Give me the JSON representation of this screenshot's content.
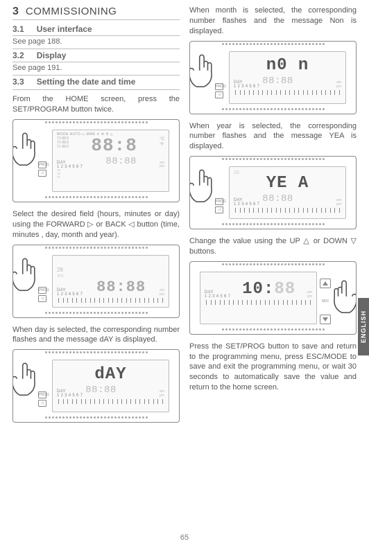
{
  "section": {
    "num": "3",
    "title": "COMMISSIONING"
  },
  "s31": {
    "num": "3.1",
    "title": "User interface",
    "see": "See page 188."
  },
  "s32": {
    "num": "3.2",
    "title": "Display",
    "see": "See page 191."
  },
  "s33": {
    "num": "3.3",
    "title": "Setting the date and time"
  },
  "left": {
    "p1": "From the HOME screen, press the SET/PROGRAM button twice.",
    "p2": "Select the desired field (hours, minutes or day) using the FORWARD ▷ or BACK ◁ button (time, minutes , day, month and year).",
    "p3": "When day is selected, the corresponding number flashes and the message dAY is displayed."
  },
  "right": {
    "p1": "When month is selected, the corresponding number flashes and the message Non is displayed.",
    "p2": "When year is selected, the corresponding number flashes and the message YEA is displayed.",
    "p3": "Change the value using the UP △ or DOWN ▽ buttons.",
    "p4": "Press the SET/PROG button to save and return to the programming menu, press ESC/MODE to save and exit the programming menu, or wait 30 seconds to automatically save the value and return to the home screen."
  },
  "lcd": {
    "mode_row": "MODE  AUTO ◇ MAN ☀ ❄ ⏱ △",
    "t_rows": "T3 88.8\nT2 88.8\nT1 88.8",
    "big_88": "88:8",
    "unit_c": "°C",
    "unit_f": "°F",
    "day_label": "DAY",
    "day_nums": "1 2 3 4 5 6 7",
    "time_88": "88:88",
    "ampm": "am\npm",
    "msg_day": "dAY",
    "msg_non": "n0 n",
    "msg_yea": "YE A",
    "val_10": "10:"
  },
  "lang_tab": "ENGLISH",
  "page_num": "65"
}
